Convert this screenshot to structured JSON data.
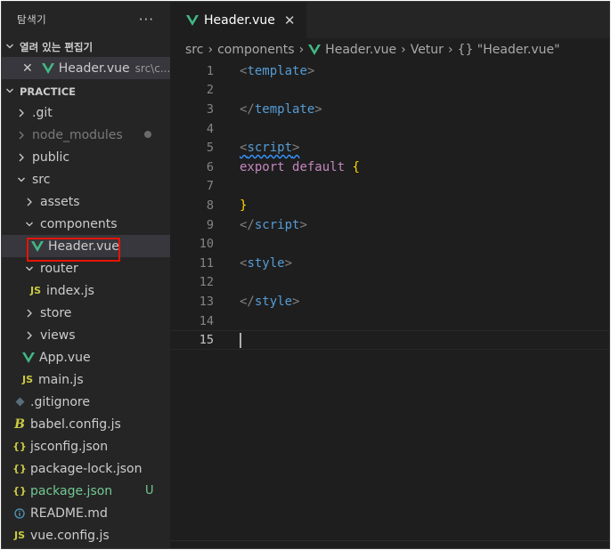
{
  "sidebar": {
    "title": "탐색기",
    "more": "···",
    "open_editors": {
      "label": "열려 있는 편집기",
      "item": {
        "name": "Header.vue",
        "path": "src\\c..."
      }
    },
    "project": {
      "label": "PRACTICE",
      "items": [
        {
          "name": ".git"
        },
        {
          "name": "node_modules"
        },
        {
          "name": "public"
        },
        {
          "name": "src"
        },
        {
          "name": "assets"
        },
        {
          "name": "components"
        },
        {
          "name": "Header.vue"
        },
        {
          "name": "router"
        },
        {
          "name": "index.js"
        },
        {
          "name": "store"
        },
        {
          "name": "views"
        },
        {
          "name": "App.vue"
        },
        {
          "name": "main.js"
        },
        {
          "name": ".gitignore"
        },
        {
          "name": "babel.config.js"
        },
        {
          "name": "jsconfig.json"
        },
        {
          "name": "package-lock.json"
        },
        {
          "name": "package.json",
          "badge": "U"
        },
        {
          "name": "README.md"
        },
        {
          "name": "vue.config.js"
        }
      ]
    }
  },
  "editor": {
    "tab": {
      "label": "Header.vue"
    },
    "breadcrumb": [
      "src",
      "components",
      "Header.vue",
      "Vetur",
      "{} \"Header.vue\""
    ],
    "lines": [
      {
        "n": "1"
      },
      {
        "n": "2"
      },
      {
        "n": "3"
      },
      {
        "n": "4"
      },
      {
        "n": "5"
      },
      {
        "n": "6"
      },
      {
        "n": "7"
      },
      {
        "n": "8"
      },
      {
        "n": "9"
      },
      {
        "n": "10"
      },
      {
        "n": "11"
      },
      {
        "n": "12"
      },
      {
        "n": "13"
      },
      {
        "n": "14"
      },
      {
        "n": "15"
      }
    ],
    "code": {
      "l1_open": "<",
      "l1_name": "template",
      "l1_close": ">",
      "l3_open": "</",
      "l3_name": "template",
      "l3_close": ">",
      "l5_open": "<",
      "l5_name": "script",
      "l5_close": ">",
      "l6_export": "export",
      "l6_default": "default",
      "l6_brace": "{",
      "l8_brace": "}",
      "l9_open": "</",
      "l9_name": "script",
      "l9_close": ">",
      "l11_open": "<",
      "l11_name": "style",
      "l11_close": ">",
      "l13_open": "</",
      "l13_name": "style",
      "l13_close": ">"
    }
  },
  "colors": {
    "vue_green": "#42b883",
    "selection_outline": "#e51400",
    "untracked_green": "#73c991"
  }
}
